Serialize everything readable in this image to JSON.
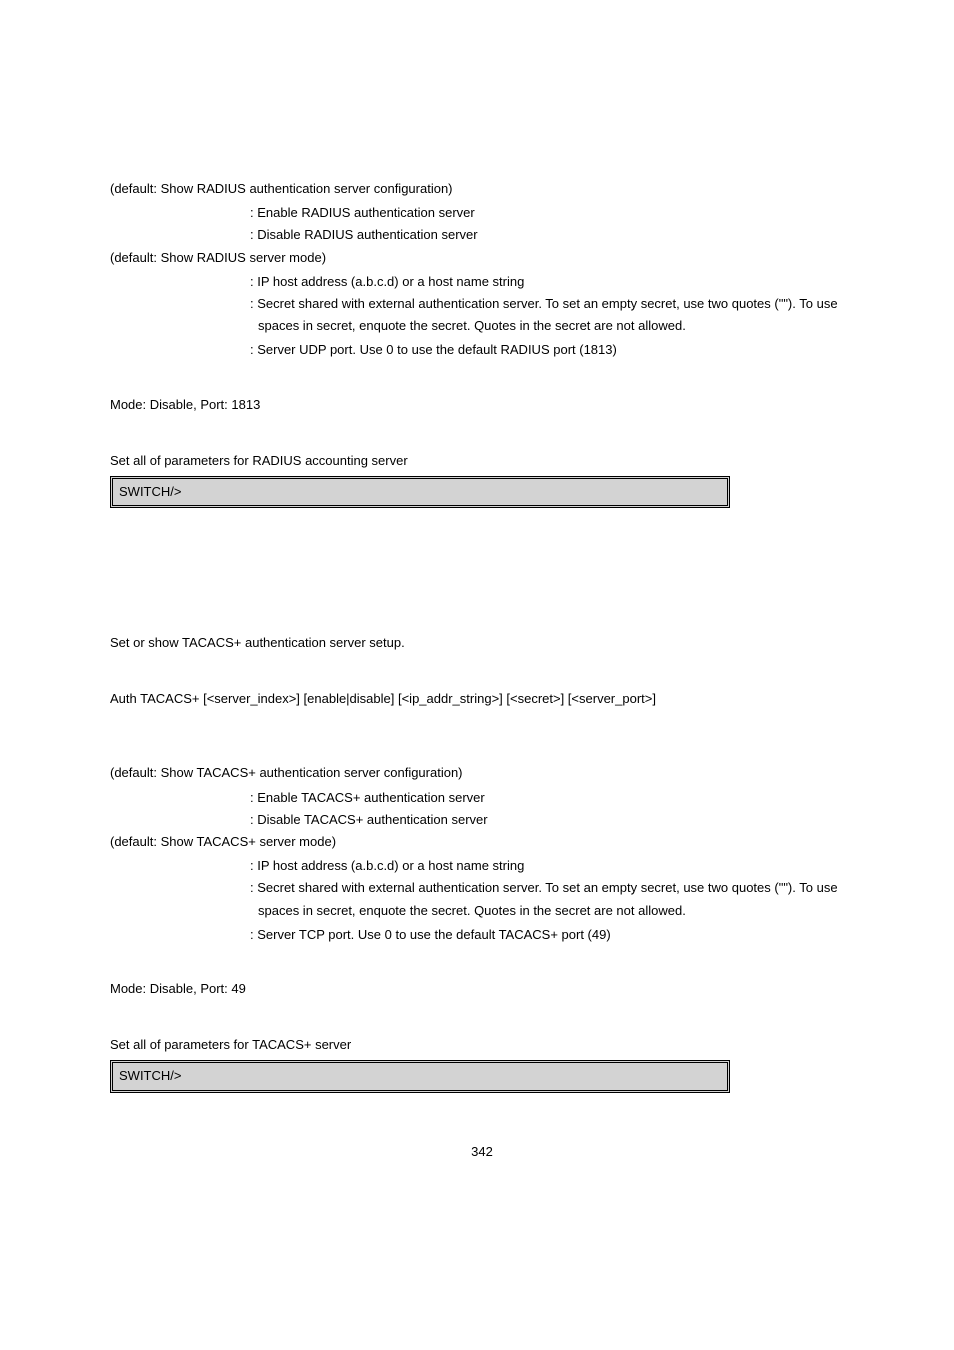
{
  "radius": {
    "server_index_note": "(default: Show RADIUS authentication server configuration)",
    "enable_desc": ": Enable RADIUS authentication server",
    "disable_desc": ": Disable RADIUS authentication server",
    "mode_note": "(default: Show RADIUS server mode)",
    "ip_desc": ": IP host address (a.b.c.d) or a host name string",
    "secret_desc_1": ": Secret shared with external authentication server. To set an empty secret, use two quotes (\"\"). To use",
    "secret_desc_2": "spaces in secret, enquote the secret. Quotes in the secret are not allowed.",
    "port_desc": ": Server UDP port. Use 0 to use the default RADIUS port (1813)",
    "default_setting": "Mode: Disable, Port: 1813",
    "example_desc": "Set all of parameters for RADIUS accounting server",
    "cmd": "SWITCH/>"
  },
  "tacacs": {
    "description": "Set or show TACACS+ authentication server setup.",
    "syntax": "Auth TACACS+ [<server_index>] [enable|disable] [<ip_addr_string>] [<secret>] [<server_port>]",
    "server_index_note": "(default: Show TACACS+ authentication server configuration)",
    "enable_desc": ": Enable TACACS+ authentication server",
    "disable_desc": ": Disable TACACS+ authentication server",
    "mode_note": "(default: Show TACACS+ server mode)",
    "ip_desc": ": IP host address (a.b.c.d) or a host name string",
    "secret_desc_1": ": Secret shared with external authentication server. To set an empty secret, use two quotes (\"\"). To use",
    "secret_desc_2": "spaces in secret, enquote the secret. Quotes in the secret are not allowed.",
    "port_desc": ": Server TCP port. Use 0 to use the default TACACS+ port (49)",
    "default_setting": "Mode: Disable, Port: 49",
    "example_desc": "Set all of parameters for TACACS+ server",
    "cmd": "SWITCH/>"
  },
  "page_number": "342"
}
